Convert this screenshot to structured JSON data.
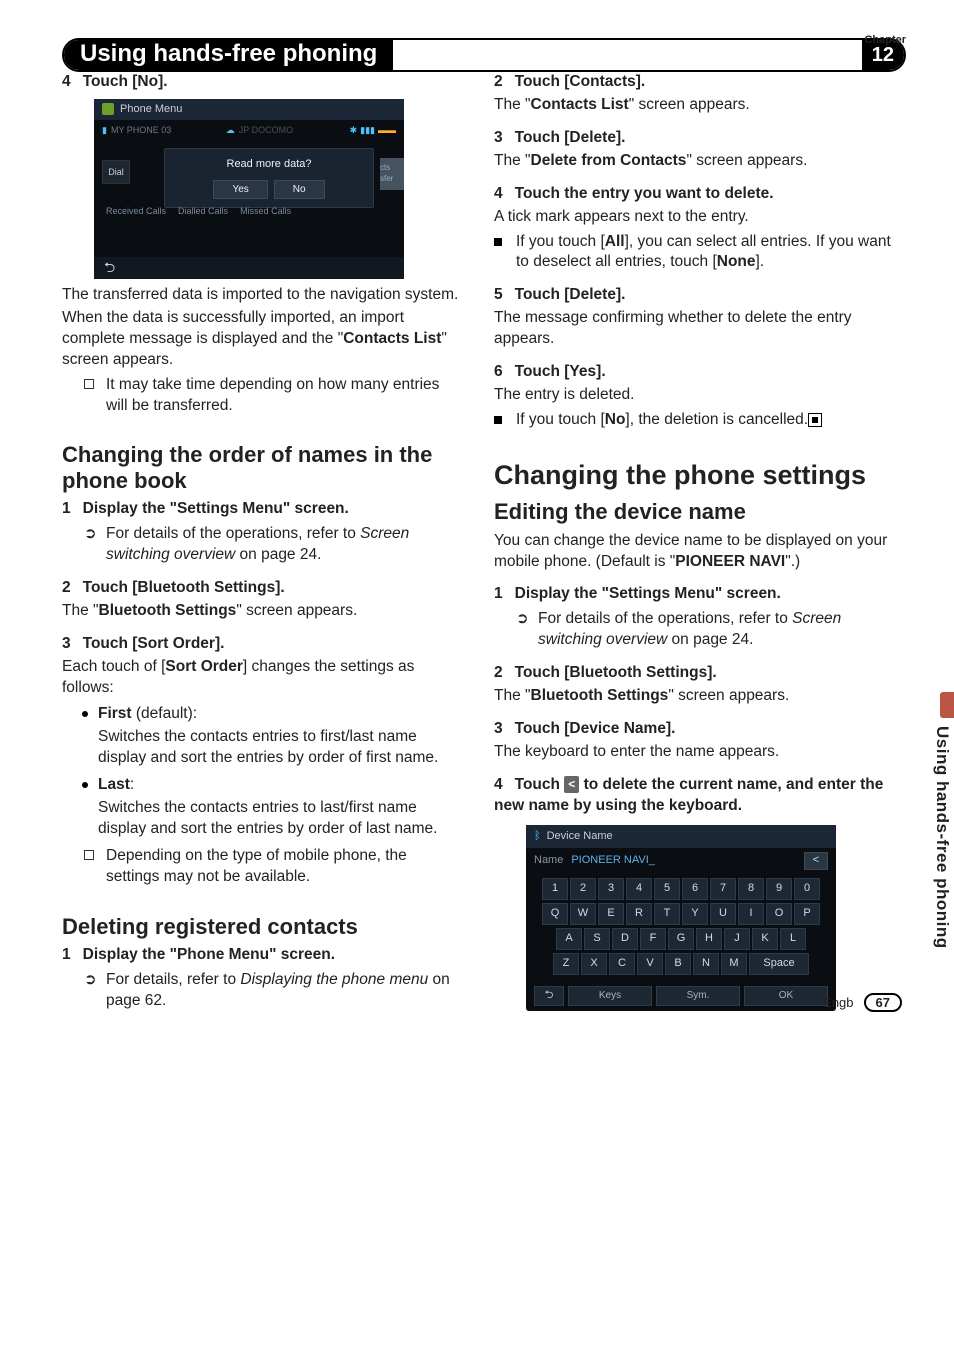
{
  "meta": {
    "chapter_label": "Chapter",
    "chapter_num": "12",
    "page_label": "Engb",
    "page_num": "67",
    "side_tab": "Using hands-free phoning"
  },
  "header": {
    "title": "Using hands-free phoning",
    "badge": "12"
  },
  "shot1": {
    "title": "Phone Menu",
    "left_device": "MY PHONE 03",
    "mid_device": "JP DOCOMO",
    "dial": "Dial",
    "msg": "Read more data?",
    "yes": "Yes",
    "no": "No",
    "side": "cts sfer",
    "tab1": "Received Calls",
    "tab2": "Dialled Calls",
    "tab3": "Missed Calls"
  },
  "left": {
    "s4": {
      "head_num": "4",
      "head_text": "Touch [No]."
    },
    "p1a": "The transferred data is imported to the navigation system.",
    "p1b_a": "When the data is successfully imported, an import complete message is displayed and the \"",
    "p1b_b": "Contacts List",
    "p1b_c": "\" screen appears.",
    "n1": "It may take time depending on how many entries will be transferred.",
    "h2a": "Changing the order of names in the phone book",
    "s1": {
      "num": "1",
      "text": "Display the \"Settings Menu\" screen."
    },
    "s1n_a": "For details of the operations, refer to ",
    "s1n_b": "Screen switching overview",
    "s1n_c": " on page 24.",
    "s2": {
      "num": "2",
      "text": "Touch [Bluetooth Settings]."
    },
    "s2b_a": "The \"",
    "s2b_b": "Bluetooth Settings",
    "s2b_c": "\" screen appears.",
    "s3": {
      "num": "3",
      "text": "Touch [Sort Order]."
    },
    "s3b_a": "Each touch of [",
    "s3b_b": "Sort Order",
    "s3b_c": "] changes the settings as follows:",
    "bul1_t": "First",
    "bul1_d": " (default):",
    "bul1_b": "Switches the contacts entries to first/last name display and sort the entries by order of first name.",
    "bul2_t": "Last",
    "bul2_d": ":",
    "bul2_b": "Switches the contacts entries to last/first name display and sort the entries by order of last name.",
    "n2": "Depending on the type of mobile phone, the settings may not be available.",
    "h2b": "Deleting registered contacts",
    "d1": {
      "num": "1",
      "text": "Display the \"Phone Menu\" screen."
    },
    "d1n_a": "For details, refer to ",
    "d1n_b": "Displaying the phone menu",
    "d1n_c": " on page 62."
  },
  "right": {
    "s2": {
      "num": "2",
      "text": "Touch [Contacts]."
    },
    "s2b_a": "The \"",
    "s2b_b": "Contacts List",
    "s2b_c": "\" screen appears.",
    "s3": {
      "num": "3",
      "text": "Touch [Delete]."
    },
    "s3b_a": "The \"",
    "s3b_b": "Delete from Contacts",
    "s3b_c": "\" screen appears.",
    "s4": {
      "num": "4",
      "text": "Touch the entry you want to delete."
    },
    "s4b": "A tick mark appears next to the entry.",
    "s4n_a": "If you touch [",
    "s4n_b": "All",
    "s4n_c": "], you can select all entries. If you want to deselect all entries, touch [",
    "s4n_d": "None",
    "s4n_e": "].",
    "s5": {
      "num": "5",
      "text": "Touch [Delete]."
    },
    "s5b": "The message confirming whether to delete the entry appears.",
    "s6": {
      "num": "6",
      "text": "Touch [Yes]."
    },
    "s6b": "The entry is deleted.",
    "s6n_a": "If you touch [",
    "s6n_b": "No",
    "s6n_c": "], the deletion is cancelled.",
    "h1": "Changing the phone settings",
    "h2": "Editing the device name",
    "p_a": "You can change the device name to be displayed on your mobile phone. (Default is \"",
    "p_b": "PIONEER NAVI",
    "p_c": "\".)",
    "e1": {
      "num": "1",
      "text": "Display the \"Settings Menu\" screen."
    },
    "e1n_a": "For details of the operations, refer to ",
    "e1n_b": "Screen switching overview",
    "e1n_c": " on page 24.",
    "e2": {
      "num": "2",
      "text": "Touch [Bluetooth Settings]."
    },
    "e2b_a": "The \"",
    "e2b_b": "Bluetooth Settings",
    "e2b_c": "\" screen appears.",
    "e3": {
      "num": "3",
      "text": "Touch [Device Name]."
    },
    "e3b": "The keyboard to enter the name appears.",
    "e4": {
      "num": "4",
      "text_a": "Touch ",
      "text_b": " to delete the current name, and enter the new name by using the keyboard."
    }
  },
  "shot2": {
    "title": "Device Name",
    "name_label": "Name",
    "name_value": "PIONEER NAVI_",
    "bs": "<",
    "r1": [
      "1",
      "2",
      "3",
      "4",
      "5",
      "6",
      "7",
      "8",
      "9",
      "0"
    ],
    "r2": [
      "Q",
      "W",
      "E",
      "R",
      "T",
      "Y",
      "U",
      "I",
      "O",
      "P"
    ],
    "r3": [
      "A",
      "S",
      "D",
      "F",
      "G",
      "H",
      "J",
      "K",
      "L"
    ],
    "r4": [
      "Z",
      "X",
      "C",
      "V",
      "B",
      "N",
      "M"
    ],
    "space": "Space",
    "keys": "Keys",
    "sym": "Sym.",
    "ok": "OK"
  }
}
